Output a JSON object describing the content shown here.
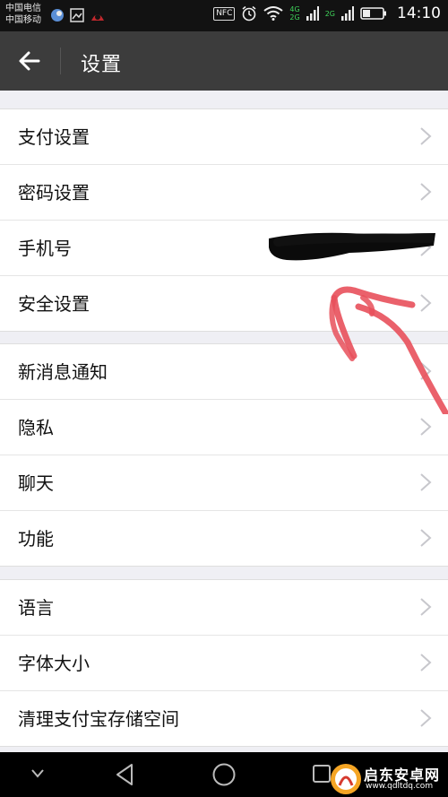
{
  "status_bar": {
    "carrier_1": "中国电信",
    "carrier_2": "中国移动",
    "nfc": "NFC",
    "net_1": "4G",
    "net_2": "2G",
    "net_3": "2G",
    "time": "14:10"
  },
  "header": {
    "title": "设置"
  },
  "groups": [
    {
      "items": [
        {
          "label": "支付设置"
        },
        {
          "label": "密码设置"
        },
        {
          "label": "手机号"
        },
        {
          "label": "安全设置"
        }
      ]
    },
    {
      "items": [
        {
          "label": "新消息通知"
        },
        {
          "label": "隐私"
        },
        {
          "label": "聊天"
        },
        {
          "label": "功能"
        }
      ]
    },
    {
      "items": [
        {
          "label": "语言"
        },
        {
          "label": "字体大小"
        },
        {
          "label": "清理支付宝存储空间"
        }
      ]
    }
  ],
  "watermark": {
    "name": "启东安卓网",
    "url": "www.qdltdq.com"
  },
  "colors": {
    "appbar": "#3c3c3c",
    "background": "#efeff4",
    "annotation": "#e8505b"
  }
}
